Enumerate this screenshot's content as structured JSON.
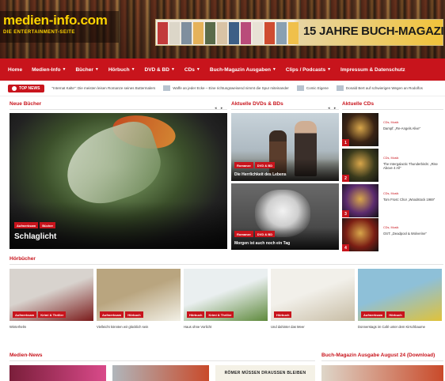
{
  "header": {
    "logo_title": "medien-info.com",
    "logo_sub": "DIE ENTERTAINMENT-SEITE",
    "banner_text": "15 JAHRE BUCH-MAGAZIN",
    "banner_covers": [
      "#c23b3b",
      "#dcd6c8",
      "#7f8f9e",
      "#e5b25a",
      "#5a6b4a",
      "#d9c3a5",
      "#3d5f86",
      "#b94c7a",
      "#e8e2d5",
      "#cf4c31",
      "#8aa0b2",
      "#f0c04b"
    ]
  },
  "nav": {
    "items": [
      {
        "label": "Home",
        "caret": false
      },
      {
        "label": "Medien-Info",
        "caret": true
      },
      {
        "label": "Bücher",
        "caret": true
      },
      {
        "label": "Hörbuch",
        "caret": true
      },
      {
        "label": "DVD & BD",
        "caret": true
      },
      {
        "label": "CDs",
        "caret": true
      },
      {
        "label": "Buch-Magazin Ausgaben",
        "caret": true
      },
      {
        "label": "Clips / Podcasts",
        "caret": true
      },
      {
        "label": "Impressum & Datenschutz",
        "caret": false
      }
    ]
  },
  "ticker": {
    "label": "TOP NEWS",
    "items": [
      "\"Internat Kalte\": Die meisten leisen Romanze seines Buttermalers",
      "Waffe an jeder Ecke – Eine richtungsweisend nimmt die Spur miteinander",
      "Comic Eigene",
      "Donald Bert auf schwierigen Wegen an Rodolfos"
    ]
  },
  "sections": {
    "neue_buecher": "Neue Bücher",
    "dvds": "Aktuelle DVDs & BDs",
    "cds": "Aktuelle CDs",
    "hoerbuecher": "Hörbücher",
    "news": "Medien-News",
    "magazin": "Buch-Magazin Ausgabe August 24 (Download)"
  },
  "hero": {
    "tags": [
      "Aufmerksam",
      "Bücher"
    ],
    "title": "Schlaglicht"
  },
  "dvds": [
    {
      "tags": [
        "Romanze",
        "DVD & BD"
      ],
      "title": "Die Herrlichkeit des Lebens"
    },
    {
      "tags": [
        "Romanze",
        "DVD & BD"
      ],
      "title": "Morgen ist auch noch ein Tag"
    }
  ],
  "cds": [
    {
      "num": "1",
      "cat": "CDs, Musik",
      "title": "Dampf: „Re-Angels Alive\"",
      "color": "#3a2314"
    },
    {
      "num": "2",
      "cat": "CDs, Musik",
      "title": "The Intergalactic Thunderbirds: „Rise Above 4 All\"",
      "color": "#3a3a1c"
    },
    {
      "num": "3",
      "cat": "CDs, Musik",
      "title": "Tom Frost: Chor „Woodstock 1969\"",
      "color": "#5b2b6e"
    },
    {
      "num": "4",
      "cat": "CDs, Musik",
      "title": "OST: „Deadpool & Wolverine\"",
      "color": "#7a1e14"
    }
  ],
  "hoerbuecher": [
    {
      "tags": [
        "Aufmerksam",
        "Krimi & Thriller"
      ],
      "title": "Winterhelm",
      "bg": [
        "#d8d3ce",
        "#7b1b1b"
      ]
    },
    {
      "tags": [
        "Aufmerksam",
        "Hörbuch"
      ],
      "title": "Vielleicht könnten wir glücklich sein",
      "bg": [
        "#b9a57f",
        "#f2f0e6"
      ]
    },
    {
      "tags": [
        "Hörbuch",
        "Krimi & Thriller"
      ],
      "title": "Haus ohne Vorlicht",
      "bg": [
        "#eaeff0",
        "#5f8a3d"
      ]
    },
    {
      "tags": [
        "Hörbuch"
      ],
      "title": "Und dahinter das Meer",
      "bg": [
        "#f2f0ea",
        "#c8bda5"
      ]
    },
    {
      "tags": [
        "Aufmerksam",
        "Hörbuch"
      ],
      "title": "Donnerstags im Café unter dem Kirschbaume",
      "bg": [
        "#8ec0d8",
        "#e0c23a"
      ]
    }
  ],
  "bottom": {
    "news_headline": "RÖMER MÜSSEN DRAUSSEN BLEIBEN",
    "colors": [
      "#7a1e3a",
      "#d94a8a",
      "#b0b6bb",
      "#f4f1e6",
      "#ded6c9",
      "#c94a2a"
    ]
  },
  "colors": {
    "accent": "#c8141c",
    "logo": "#ffd400"
  }
}
